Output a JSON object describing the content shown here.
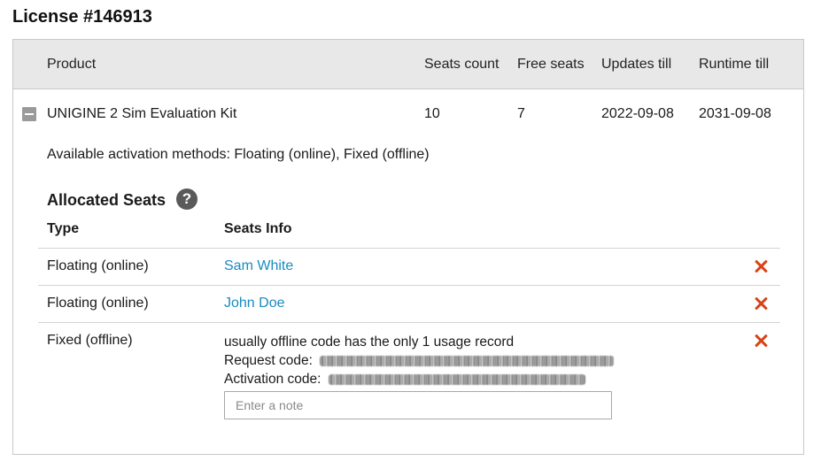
{
  "page": {
    "title": "License #146913"
  },
  "table": {
    "headers": {
      "product": "Product",
      "seats_count": "Seats count",
      "free_seats": "Free seats",
      "updates_till": "Updates till",
      "runtime_till": "Runtime till"
    },
    "row": {
      "product": "UNIGINE 2 Sim Evaluation Kit",
      "seats_count": "10",
      "free_seats": "7",
      "updates_till": "2022-09-08",
      "runtime_till": "2031-09-08"
    }
  },
  "details": {
    "activation_methods": "Available activation methods: Floating (online), Fixed (offline)",
    "allocated_title": "Allocated Seats",
    "help_glyph": "?",
    "seats_headers": {
      "type": "Type",
      "info": "Seats Info"
    },
    "seats": [
      {
        "type": "Floating (online)",
        "user": "Sam White"
      },
      {
        "type": "Floating (online)",
        "user": "John Doe"
      },
      {
        "type": "Fixed (offline)",
        "note_line": "usually offline code has the only 1 usage record",
        "request_label": "Request code:",
        "activation_label": "Activation code:",
        "note_placeholder": "Enter a note"
      }
    ]
  },
  "icons": {
    "collapse": "minus-square-icon",
    "help": "question-circle-icon",
    "remove": "close-icon"
  },
  "colors": {
    "link": "#1a8bbf",
    "remove": "#d84315",
    "header_bg": "#e8e8e8"
  }
}
